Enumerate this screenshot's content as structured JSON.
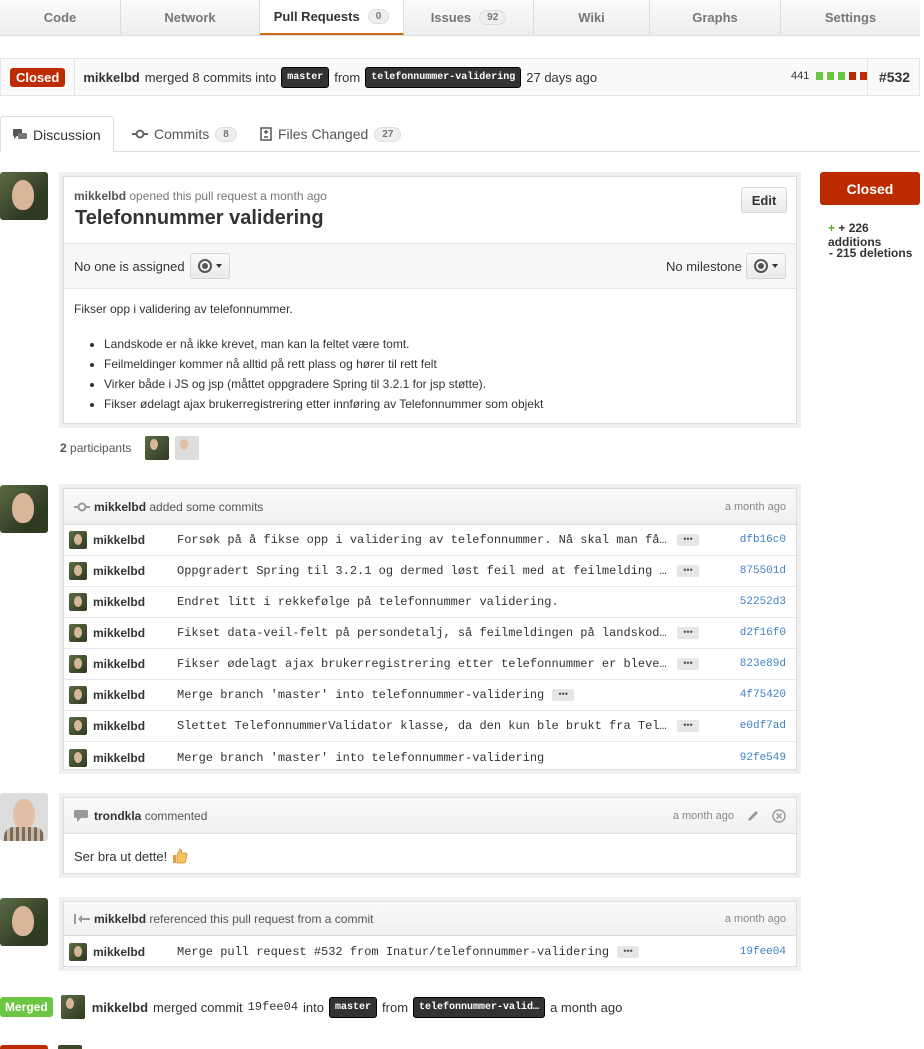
{
  "repo_nav": {
    "code": "Code",
    "network": "Network",
    "pull_requests": "Pull Requests",
    "pull_requests_count": "0",
    "issues": "Issues",
    "issues_count": "92",
    "wiki": "Wiki",
    "graphs": "Graphs",
    "settings": "Settings"
  },
  "pr_bar": {
    "state": "Closed",
    "author": "mikkelbd",
    "merged_text": "merged 8 commits into",
    "base_branch": "master",
    "from_text": "from",
    "head_branch": "telefonnummer-validering",
    "time": "27 days ago",
    "diffstat_count": "441",
    "number": "#532",
    "colors": {
      "state": "#bd2c00",
      "add": "#6cc644",
      "del": "#bd2c00"
    }
  },
  "tabs": {
    "discussion": "Discussion",
    "commits": "Commits",
    "commits_count": "8",
    "files": "Files Changed",
    "files_count": "27"
  },
  "opening": {
    "author": "mikkelbd",
    "meta": "opened this pull request a month ago",
    "title": "Telefonnummer validering",
    "edit": "Edit",
    "assignee": "No one is assigned",
    "milestone": "No milestone",
    "intro": "Fikser opp i validering av telefonnummer.",
    "bullets": [
      "Landskode er nå ikke krevet, man kan la feltet være tomt.",
      "Feilmeldinger kommer nå alltid på rett plass og hører til rett felt",
      "Virker både i JS og jsp (måttet oppgradere Spring til 3.2.1 for jsp støtte).",
      "Fikser ødelagt ajax brukerregistrering etter innføring av Telefonnummer som objekt"
    ]
  },
  "participants": {
    "count": "2",
    "label": "participants"
  },
  "sidebar": {
    "state": "Closed",
    "additions": "+ 226 additions",
    "deletions": "- 215 deletions"
  },
  "commits_box": {
    "author": "mikkelbd",
    "action": "added some commits",
    "time": "a month ago",
    "rows": [
      {
        "author": "mikkelbd",
        "msg": "Forsøk på å fikse opp i validering av telefonnummer. Nå skal man få beskjed",
        "ell": true,
        "sha": "dfb16c0"
      },
      {
        "author": "mikkelbd",
        "msg": "Oppgradert Spring til 3.2.1 og dermed løst feil med at feilmelding ikke",
        "ell": true,
        "sha": "875501d"
      },
      {
        "author": "mikkelbd",
        "msg": "Endret litt i rekkefølge på telefonnummer validering.",
        "ell": false,
        "sha": "52252d3"
      },
      {
        "author": "mikkelbd",
        "msg": "Fikset data-veil-felt på persondetalj, så feilmeldingen på landskode havner",
        "ell": true,
        "sha": "d2f16f0"
      },
      {
        "author": "mikkelbd",
        "msg": "Fikser ødelagt ajax brukerregistrering etter telefonnummer er blevet objekt",
        "ell": true,
        "sha": "823e89d"
      },
      {
        "author": "mikkelbd",
        "msg": "Merge branch 'master' into telefonnummer-validering",
        "ell": true,
        "sha": "4f75420"
      },
      {
        "author": "mikkelbd",
        "msg": "Slettet TelefonnummerValidator klasse, da den kun ble brukt fra Telefonnummer",
        "ell": true,
        "sha": "e0df7ad"
      },
      {
        "author": "mikkelbd",
        "msg": "Merge branch 'master' into telefonnummer-validering",
        "ell": false,
        "sha": "92fe549"
      }
    ]
  },
  "comment": {
    "author": "trondkla",
    "action": "commented",
    "time": "a month ago",
    "body": "Ser bra ut dette!"
  },
  "reference": {
    "author": "mikkelbd",
    "action": "referenced this pull request from a commit",
    "time": "a month ago",
    "row": {
      "author": "mikkelbd",
      "msg": "Merge pull request #532 from Inatur/telefonnummer-validering",
      "sha": "19fee04"
    }
  },
  "merged_event": {
    "label": "Merged",
    "author": "mikkelbd",
    "text": "merged commit",
    "sha": "19fee04",
    "into": "into",
    "base_branch": "master",
    "from": "from",
    "head_branch": "telefonnummer-valid…",
    "time": "a month ago"
  }
}
